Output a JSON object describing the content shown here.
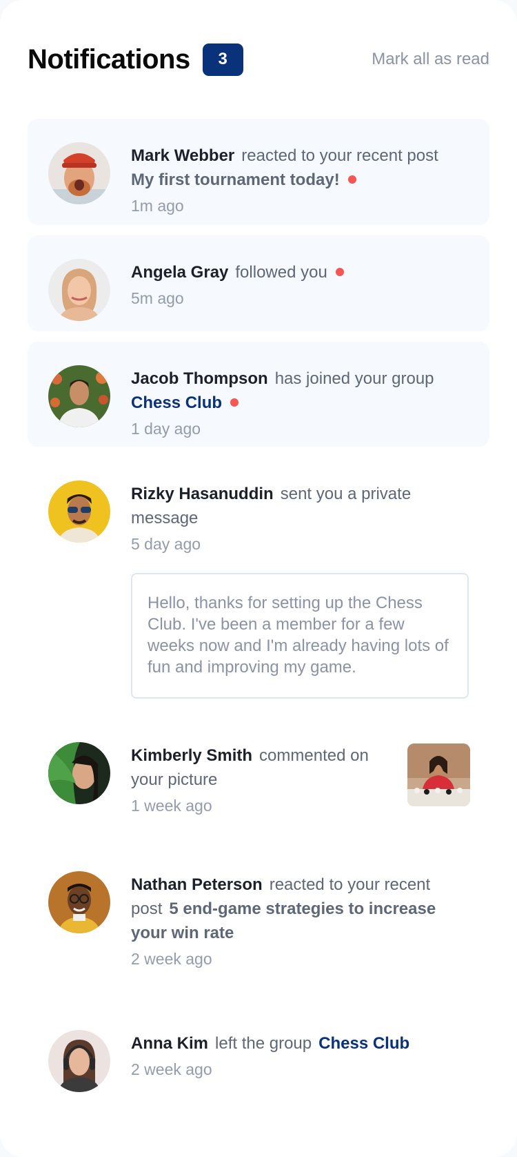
{
  "header": {
    "title": "Notifications",
    "unread_count": "3",
    "mark_all_label": "Mark all as read"
  },
  "notifications": [
    {
      "name": "Mark Webber",
      "action": "reacted to your recent post",
      "post": "My first tournament today!",
      "time": "1m ago",
      "unread": true
    },
    {
      "name": "Angela Gray",
      "action": "followed you",
      "time": "5m ago",
      "unread": true
    },
    {
      "name": "Jacob Thompson",
      "action": "has joined your group",
      "group": "Chess Club",
      "time": "1 day ago",
      "unread": true
    },
    {
      "name": "Rizky Hasanuddin",
      "action": "sent you a private message",
      "time": "5 day ago",
      "message": "Hello, thanks for setting up the Chess Club. I've been a member for a few weeks now and I'm already having lots of fun and improving my game.",
      "unread": false
    },
    {
      "name": "Kimberly Smith",
      "action": "commented on your picture",
      "time": "1 week ago",
      "unread": false
    },
    {
      "name": "Nathan Peterson",
      "action": "reacted to your recent post",
      "post": "5 end-game strategies to increase your win rate",
      "time": "2 week ago",
      "unread": false
    },
    {
      "name": "Anna Kim",
      "action": "left the group",
      "group": "Chess Club",
      "time": "2 week ago",
      "unread": false
    }
  ],
  "colors": {
    "accent_navy": "#0a327b",
    "unread_dot": "#f65552",
    "unread_bg": "#f6f9fd",
    "muted_text": "#5e6778",
    "light_text": "#939cad"
  }
}
